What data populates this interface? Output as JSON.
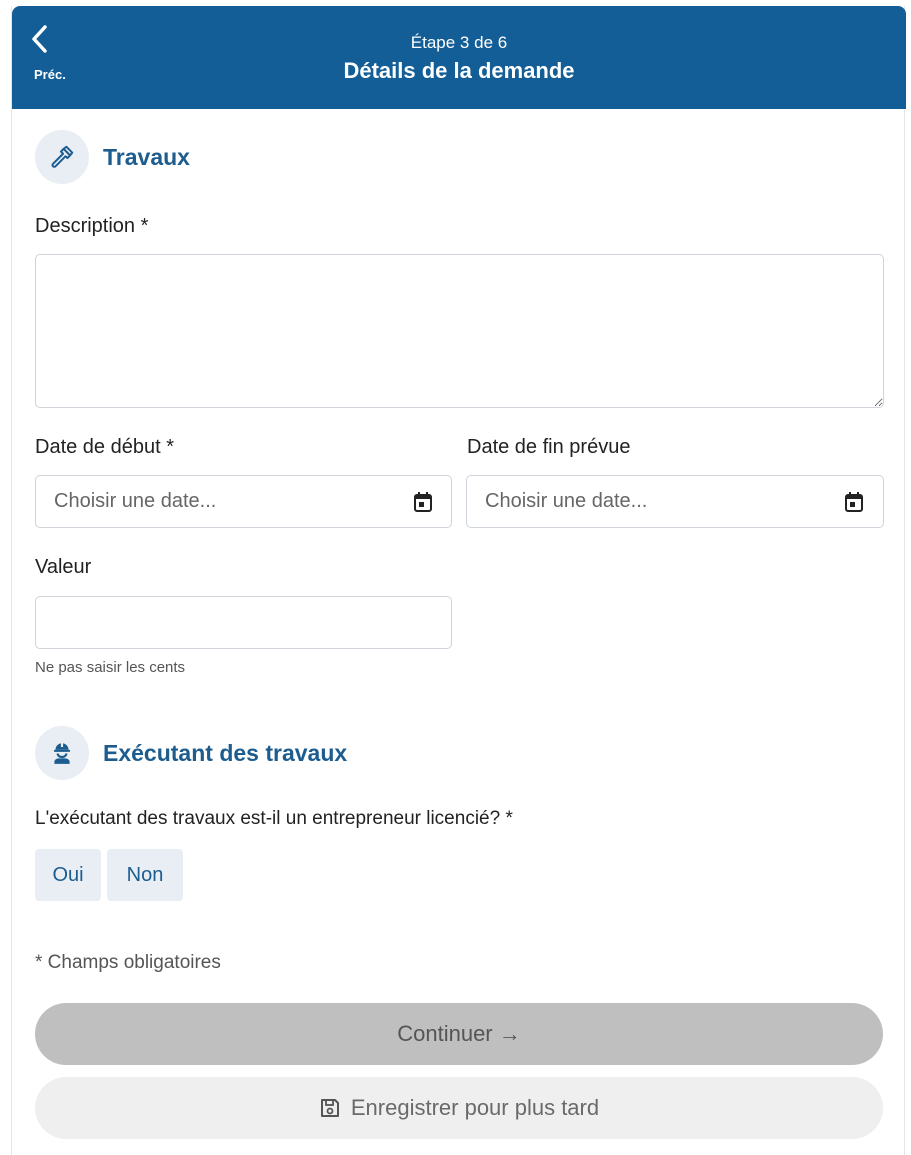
{
  "header": {
    "back_label": "Préc.",
    "step_text": "Étape 3 de 6",
    "title": "Détails de la demande",
    "color": "#135e96"
  },
  "travaux": {
    "title": "Travaux",
    "icon": "hammer-icon",
    "description_label": "Description *",
    "description_value": "",
    "start_date_label": "Date de début *",
    "start_date_placeholder": "Choisir une date...",
    "end_date_label": "Date de fin prévue",
    "end_date_placeholder": "Choisir une date...",
    "value_label": "Valeur",
    "value_input": "",
    "value_hint": "Ne pas saisir les cents"
  },
  "executant": {
    "title": "Exécutant des travaux",
    "icon": "worker-icon",
    "question": "L'exécutant des travaux est-il un entrepreneur licencié? *",
    "options": [
      "Oui",
      "Non"
    ]
  },
  "footer": {
    "required_note": "* Champs obligatoires",
    "continue_label": "Continuer →",
    "save_label": "Enregistrer pour plus tard"
  },
  "colors": {
    "accent": "#1c5c8f",
    "chip_bg": "#e8eef4",
    "continue_bg": "#bfbfbf",
    "save_bg": "#efefef"
  }
}
